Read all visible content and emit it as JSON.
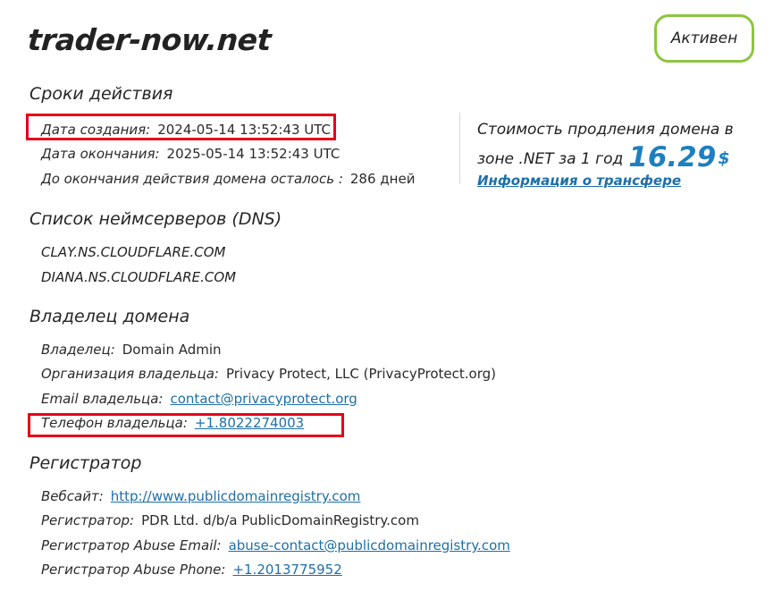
{
  "domain": "trader-now.net",
  "status": "Активен",
  "validity": {
    "heading": "Сроки действия",
    "created_label": "Дата создания:",
    "created_value": "2024-05-14 13:52:43 UTC",
    "expires_label": "Дата окончания:",
    "expires_value": "2025-05-14 13:52:43 UTC",
    "remaining_label": "До окончания действия домена осталось :",
    "remaining_value": "286 дней"
  },
  "renewal": {
    "text": "Стоимость продления домена в зоне .NET за 1 год",
    "price": "16.29",
    "currency": "$",
    "transfer_link": "Информация о трансфере"
  },
  "nameservers": {
    "heading": "Список неймсерверов (DNS)",
    "items": [
      "CLAY.NS.CLOUDFLARE.COM",
      "DIANA.NS.CLOUDFLARE.COM"
    ]
  },
  "owner": {
    "heading": "Владелец домена",
    "name_label": "Владелец:",
    "name_value": "Domain Admin",
    "org_label": "Организация владельца:",
    "org_value": "Privacy Protect, LLC (PrivacyProtect.org)",
    "email_label": "Email владельца:",
    "email_value": "contact@privacyprotect.org",
    "phone_label": "Телефон владельца:",
    "phone_value": "+1.8022274003"
  },
  "registrar": {
    "heading": "Регистратор",
    "website_label": "Вебсайт:",
    "website_value": "http://www.publicdomainregistry.com",
    "name_label": "Регистратор:",
    "name_value": "PDR Ltd. d/b/a PublicDomainRegistry.com",
    "abuse_email_label": "Регистратор Abuse Email:",
    "abuse_email_value": "abuse-contact@publicdomainregistry.com",
    "abuse_phone_label": "Регистратор Abuse Phone:",
    "abuse_phone_value": "+1.2013775952"
  },
  "colors": {
    "accent_blue": "#1e7fc0",
    "link_blue": "#1e6fa8",
    "status_border": "#8cc63f",
    "highlight_red": "#e6001a"
  }
}
